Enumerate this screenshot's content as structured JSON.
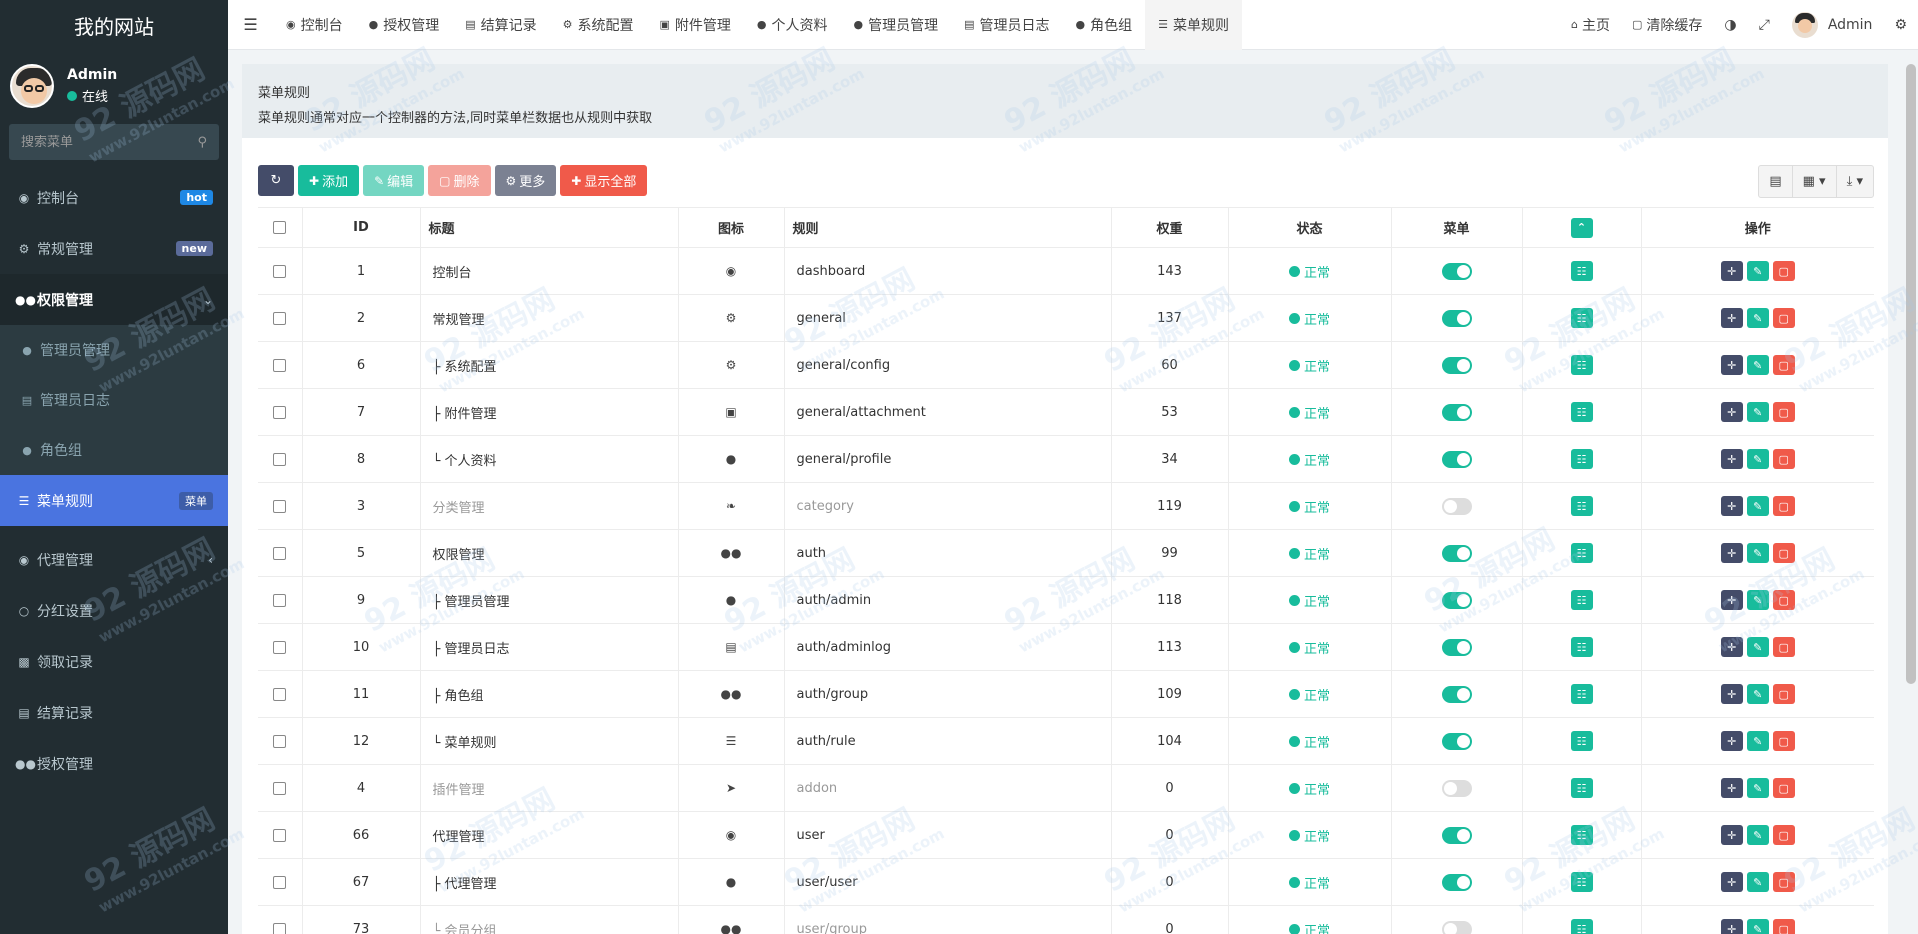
{
  "site": {
    "title": "我的网站"
  },
  "user": {
    "name": "Admin",
    "status": "在线"
  },
  "search": {
    "placeholder": "搜索菜单"
  },
  "sidebar": {
    "items": [
      {
        "label": "控制台",
        "icon": "dashboard-icon",
        "badge": "hot"
      },
      {
        "label": "常规管理",
        "icon": "cogs-icon",
        "badge": "new"
      },
      {
        "label": "权限管理",
        "icon": "group-icon"
      },
      {
        "label": "代理管理",
        "icon": "user-circle-icon"
      },
      {
        "label": "分红设置",
        "icon": "circle-icon"
      },
      {
        "label": "领取记录",
        "icon": "bar-chart-icon"
      },
      {
        "label": "结算记录",
        "icon": "list-alt-icon"
      },
      {
        "label": "授权管理",
        "icon": "group-icon"
      }
    ],
    "sub_items": [
      {
        "label": "管理员管理",
        "icon": "user-icon"
      },
      {
        "label": "管理员日志",
        "icon": "list-alt-icon"
      },
      {
        "label": "角色组",
        "icon": "group-icon"
      },
      {
        "label": "菜单规则",
        "icon": "bars-icon",
        "badge": "菜单"
      }
    ]
  },
  "navbar": {
    "tabs": [
      {
        "label": "控制台",
        "icon": "dashboard-icon"
      },
      {
        "label": "授权管理",
        "icon": "group-icon"
      },
      {
        "label": "结算记录",
        "icon": "list-alt-icon"
      },
      {
        "label": "系统配置",
        "icon": "cog-icon"
      },
      {
        "label": "附件管理",
        "icon": "file-image-icon"
      },
      {
        "label": "个人资料",
        "icon": "user-icon"
      },
      {
        "label": "管理员管理",
        "icon": "user-icon"
      },
      {
        "label": "管理员日志",
        "icon": "list-alt-icon"
      },
      {
        "label": "角色组",
        "icon": "group-icon"
      },
      {
        "label": "菜单规则",
        "icon": "bars-icon"
      }
    ],
    "home": "主页",
    "clear_cache": "清除缓存",
    "admin": "Admin"
  },
  "header": {
    "title": "菜单规则",
    "description": "菜单规则通常对应一个控制器的方法,同时菜单栏数据也从规则中获取"
  },
  "toolbar": {
    "add": "添加",
    "edit": "编辑",
    "delete": "删除",
    "more": "更多",
    "show_all": "显示全部"
  },
  "table": {
    "columns": [
      "ID",
      "标题",
      "图标",
      "规则",
      "权重",
      "状态",
      "菜单",
      "操作"
    ],
    "status_label": "正常",
    "rows": [
      {
        "id": "1",
        "title": "控制台",
        "icon": "dashboard-icon",
        "rule": "dashboard",
        "weigh": "143",
        "menu": true
      },
      {
        "id": "2",
        "title": "常规管理",
        "icon": "cogs-icon",
        "rule": "general",
        "weigh": "137",
        "menu": true
      },
      {
        "id": "6",
        "title": "├ 系统配置",
        "icon": "cog-icon",
        "rule": "general/config",
        "weigh": "60",
        "menu": true
      },
      {
        "id": "7",
        "title": "├ 附件管理",
        "icon": "file-image-icon",
        "rule": "general/attachment",
        "weigh": "53",
        "menu": true
      },
      {
        "id": "8",
        "title": "└ 个人资料",
        "icon": "user-icon",
        "rule": "general/profile",
        "weigh": "34",
        "menu": true
      },
      {
        "id": "3",
        "title": "分类管理",
        "icon": "leaf-icon",
        "rule": "category",
        "weigh": "119",
        "menu": false
      },
      {
        "id": "5",
        "title": "权限管理",
        "icon": "group-icon",
        "rule": "auth",
        "weigh": "99",
        "menu": true
      },
      {
        "id": "9",
        "title": "├ 管理员管理",
        "icon": "user-icon",
        "rule": "auth/admin",
        "weigh": "118",
        "menu": true
      },
      {
        "id": "10",
        "title": "├ 管理员日志",
        "icon": "list-alt-icon",
        "rule": "auth/adminlog",
        "weigh": "113",
        "menu": true
      },
      {
        "id": "11",
        "title": "├ 角色组",
        "icon": "group-icon",
        "rule": "auth/group",
        "weigh": "109",
        "menu": true
      },
      {
        "id": "12",
        "title": "└ 菜单规则",
        "icon": "bars-icon",
        "rule": "auth/rule",
        "weigh": "104",
        "menu": true
      },
      {
        "id": "4",
        "title": "插件管理",
        "icon": "rocket-icon",
        "rule": "addon",
        "weigh": "0",
        "menu": false
      },
      {
        "id": "66",
        "title": "代理管理",
        "icon": "user-circle-icon",
        "rule": "user",
        "weigh": "0",
        "menu": true
      },
      {
        "id": "67",
        "title": "├ 代理管理",
        "icon": "user-icon",
        "rule": "user/user",
        "weigh": "0",
        "menu": true
      },
      {
        "id": "73",
        "title": "└ 会员分组",
        "icon": "group-icon",
        "rule": "user/group",
        "weigh": "0",
        "menu": false
      }
    ]
  },
  "watermark": {
    "text": "92 源码网",
    "url": "www.92luntan.com"
  },
  "colors": {
    "accent": "#18bc9c",
    "sidebar": "#222d32",
    "active": "#4a74e0",
    "danger": "#f05a4a",
    "dark_btn": "#444c69"
  }
}
